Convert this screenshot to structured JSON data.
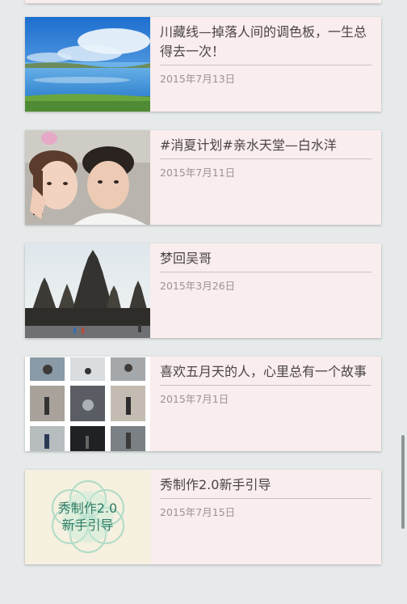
{
  "posts": [
    {
      "title": "川藏线—掉落人间的调色板，一生总得去一次！",
      "date": "2015年7月13日"
    },
    {
      "title": "#消夏计划#亲水天堂—白水洋",
      "date": "2015年7月11日"
    },
    {
      "title": "梦回吴哥",
      "date": "2015年3月26日"
    },
    {
      "title": "喜欢五月天的人，心里总有一个故事",
      "date": "2015年7月1日"
    },
    {
      "title": "秀制作2.0新手引导",
      "date": "2015年7月15日",
      "thumb_text": [
        "秀制作2.0",
        "新手引导"
      ]
    }
  ]
}
